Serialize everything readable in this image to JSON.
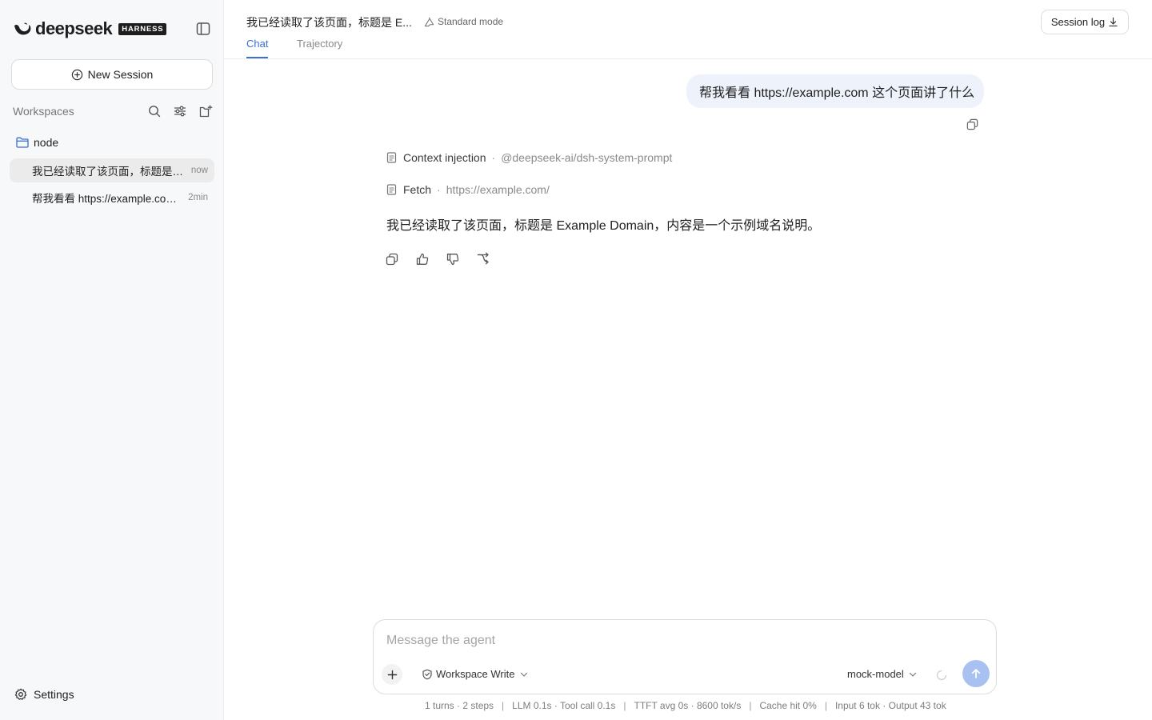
{
  "brand": {
    "name": "deepseek",
    "badge": "HARNESS"
  },
  "sidebar": {
    "new_session_label": "New Session",
    "workspaces_label": "Workspaces",
    "folder": "node",
    "sessions": [
      {
        "title": "我已经读取了该页面，标题是 Example Domain，内容是一个示例域名说明。",
        "time": "now",
        "active": true
      },
      {
        "title": "帮我看看 https://example.com 这个页面讲了什么",
        "time": "2min",
        "active": false
      }
    ],
    "settings_label": "Settings"
  },
  "header": {
    "title": "我已经读取了该页面，标题是 E...",
    "mode": "Standard mode",
    "tabs": [
      {
        "label": "Chat"
      },
      {
        "label": "Trajectory"
      }
    ],
    "session_log_label": "Session log"
  },
  "chat": {
    "user_message": "帮我看看 https://example.com 这个页面讲了什么",
    "tools": [
      {
        "name": "Context injection",
        "detail": "@deepseek-ai/dsh-system-prompt"
      },
      {
        "name": "Fetch",
        "detail": "https://example.com/"
      }
    ],
    "answer": "我已经读取了该页面，标题是 Example Domain，内容是一个示例域名说明。"
  },
  "composer": {
    "placeholder": "Message the agent",
    "permission": "Workspace Write",
    "model": "mock-model"
  },
  "stats": {
    "turns": "1 turns · 2 steps",
    "timing": "LLM 0.1s · Tool call 0.1s",
    "ttft": "TTFT avg 0s · 8600 tok/s",
    "cache": "Cache hit 0%",
    "tokens": "Input 6 tok · Output 43 tok"
  },
  "colors": {
    "accent": "#3b6fd1",
    "user_bubble": "#eef2fb",
    "send_button": "#a9c1f0",
    "sidebar_bg": "#f7f8fa"
  }
}
